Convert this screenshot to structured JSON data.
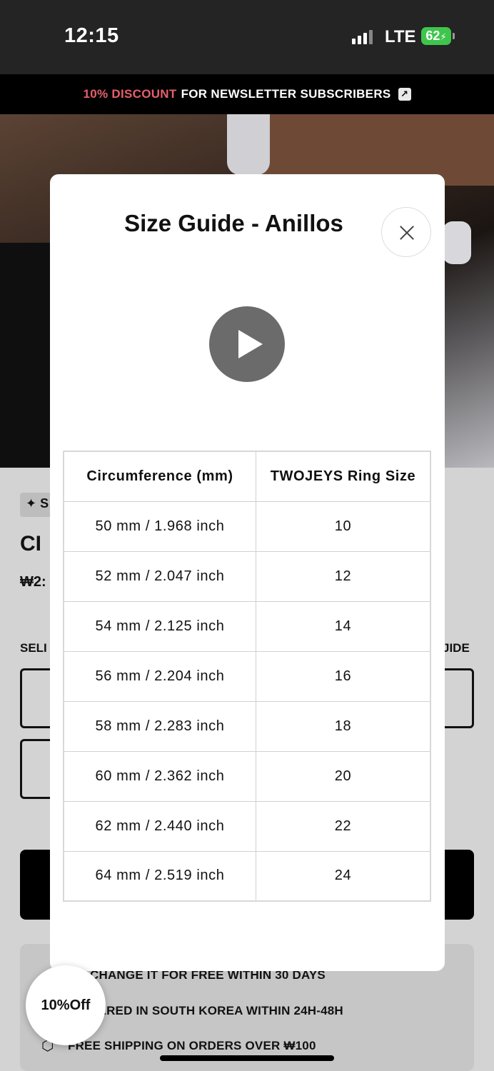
{
  "status": {
    "time": "12:15",
    "network": "LTE",
    "battery": "62"
  },
  "announcement": {
    "highlight": "10% DISCOUNT",
    "text": "FOR NEWSLETTER SUBSCRIBERS",
    "icon": "external-link-icon"
  },
  "page": {
    "badge": "✦ S",
    "title": "CI",
    "price": "₩2:",
    "select_label": "SELI",
    "size_guide_label": "JIDE",
    "info_lines": [
      "CHANGE IT FOR FREE WITHIN 30 DAYS",
      "VERED IN SOUTH KOREA WITHIN 24H-48H",
      "FREE SHIPPING ON ORDERS OVER ₩100"
    ]
  },
  "discount_bubble": "10%Off",
  "modal": {
    "title": "Size Guide - Anillos",
    "close_icon": "close-icon",
    "video_icon": "play-icon",
    "table": {
      "headers": [
        "Circumference (mm)",
        "TWOJEYS Ring Size"
      ],
      "rows": [
        [
          "50 mm / 1.968 inch",
          "10"
        ],
        [
          "52 mm / 2.047 inch",
          "12"
        ],
        [
          "54 mm / 2.125 inch",
          "14"
        ],
        [
          "56 mm / 2.204 inch",
          "16"
        ],
        [
          "58 mm / 2.283 inch",
          "18"
        ],
        [
          "60 mm / 2.362 inch",
          "20"
        ],
        [
          "62 mm / 2.440 inch",
          "22"
        ],
        [
          "64 mm / 2.519 inch",
          "24"
        ]
      ]
    }
  }
}
